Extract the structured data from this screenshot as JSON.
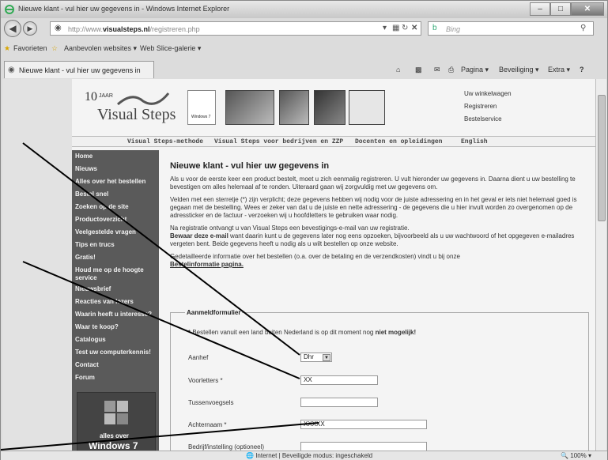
{
  "window": {
    "title": "Nieuwe klant - vul hier uw gegevens in - Windows Internet Explorer"
  },
  "address": {
    "url_prefix": "http://www.",
    "url_domain": "visualsteps.nl",
    "url_path": "/registreren.php",
    "search_placeholder": "Bing"
  },
  "favorites": {
    "label": "Favorieten",
    "item1": "Aanbevolen websites ▾",
    "item2": "Web Slice-galerie ▾"
  },
  "tab": {
    "title": "Nieuwe klant - vul hier uw gegevens in"
  },
  "commandbar": {
    "page": "Pagina ▾",
    "security": "Beveiliging ▾",
    "extra": "Extra ▾"
  },
  "site": {
    "logo_ten": "10",
    "logo_jaar": "JAAR",
    "logo_name": "Visual Steps",
    "book_label": "Windows 7",
    "toplinks": [
      "Uw winkelwagen",
      "Registreren",
      "Bestelservice"
    ],
    "topnav": [
      "Visual Steps-methode",
      "Visual Steps voor bedrijven en ZZP",
      "Docenten en opleidingen",
      "English"
    ]
  },
  "sidebar": {
    "items": [
      "Home",
      "Nieuws",
      "Alles over het bestellen",
      "Bestel snel",
      "Zoeken op de site",
      "Productoverzicht",
      "Veelgestelde vragen",
      "Tips en trucs",
      "Gratis!",
      "Houd me op de hoogte service",
      "Nieuwsbrief",
      "Reacties van lezers",
      "Waarin heeft u interesse?",
      "Waar te koop?",
      "Catalogus",
      "Test uw computerkennis!",
      "Contact",
      "Forum"
    ],
    "promo_small": "alles over",
    "promo_big": "Windows 7"
  },
  "content": {
    "heading": "Nieuwe klant - vul hier uw gegevens in",
    "p1": "Als u voor de eerste keer een product bestelt, moet u zich eenmalig registreren. U vult hieronder uw gegevens in. Daarna dient u uw bestelling te bevestigen om alles helemaal af te ronden. Uiteraard gaan wij zorgvuldig met uw gegevens om.",
    "p2": "Velden met een sterretje (*) zijn verplicht; deze gegevens hebben wij nodig voor de juiste adressering en in het geval er iets niet helemaal goed is gegaan met de bestelling. Wees er zeker van dat u de juiste en nette adressering - de gegevens die u hier invult worden zo overgenomen op de adressticker en de factuur - verzoeken wij u hoofdletters te gebruiken waar nodig.",
    "p3a": "Na registratie ontvangt u van Visual Steps een bevestigings-e-mail van uw registratie.",
    "p3b_bold": "Bewaar deze e-mail",
    "p3b": " want daarin kunt u de gegevens later nog eens opzoeken, bijvoorbeeld als u uw wachtwoord of het opgegeven e-mailadres vergeten bent. Beide gegevens heeft u nodig als u wilt bestellen op onze website.",
    "p4": "Gedetailleerde informatie over het bestellen (o.a. over de betaling en de verzendkosten) vindt u bij onze",
    "p4_link": "Bestelinformatie pagina."
  },
  "form": {
    "legend": "Aanmeldformulier",
    "notice_prefix": "* Bestellen vanuit een land buiten Nederland is op dit moment nog ",
    "notice_bold": "niet mogelijk!",
    "fields": [
      {
        "label": "Aanhef",
        "value": "Dhr"
      },
      {
        "label": "Voorletters *",
        "value": "XX"
      },
      {
        "label": "Tussenvoegsels",
        "value": ""
      },
      {
        "label": "Achternaam *",
        "value": "XXXXX"
      },
      {
        "label": "Bedrijf/instelling (optioneel)",
        "value": ""
      }
    ]
  },
  "status": {
    "text": "Internet | Beveiligde modus: ingeschakeld",
    "zoom": "100%"
  }
}
